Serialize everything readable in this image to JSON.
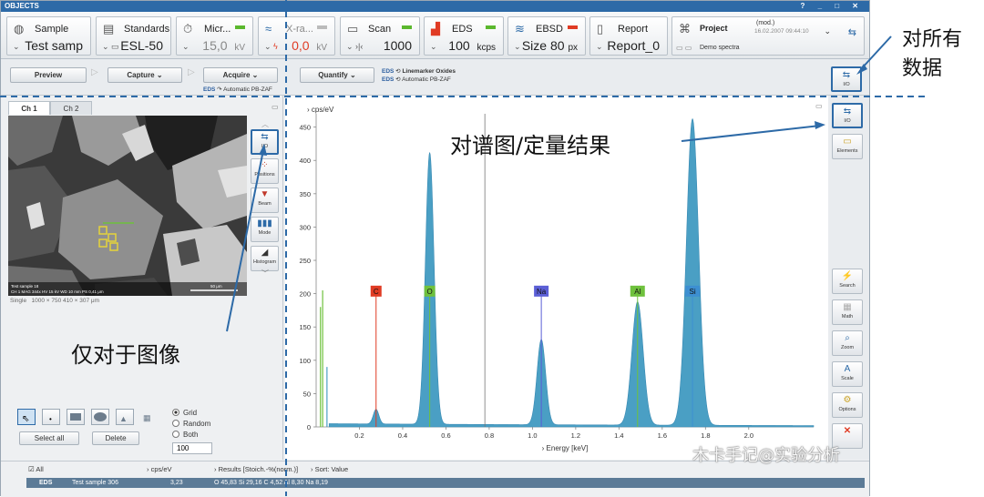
{
  "window": {
    "title": "OBJECTS",
    "controls": "? _ □ ✕"
  },
  "objects": [
    {
      "label": "Sample",
      "value": "Test samp",
      "icon": "sample-icon",
      "led": ""
    },
    {
      "label": "Standards",
      "value": "ESL-50",
      "icon": "standards-icon",
      "led": ""
    },
    {
      "label": "Micr...",
      "value": "15,0",
      "unit": "kV",
      "icon": "microscope-icon",
      "led": "#5bb82e"
    },
    {
      "label": "X-ra...",
      "value": "0,0",
      "unit": "kV",
      "icon": "xray-icon",
      "led": "#bbbbbb"
    },
    {
      "label": "Scan",
      "value": "1000",
      "icon": "scan-icon",
      "led": "#5bb82e"
    },
    {
      "label": "EDS",
      "value": "100",
      "unit": "kcps",
      "icon": "eds-icon",
      "led": "#5bb82e"
    },
    {
      "label": "EBSD",
      "value": "Size  80",
      "unit": "px",
      "icon": "ebsd-icon",
      "led": "#e03b24"
    },
    {
      "label": "Report",
      "value": "Report_0",
      "icon": "report-icon",
      "led": ""
    },
    {
      "label": "Project",
      "value": "Demo spectra",
      "note": "(mod.)",
      "date": "16.02.2007 09:44:10",
      "icon": "project-icon",
      "led": ""
    }
  ],
  "toolbar": {
    "preview": "Preview",
    "capture": "Capture",
    "acquire": "Acquire",
    "quantify": "Quantify",
    "eds_tag": "EDS",
    "automatic1": "Automatic PB-ZAF",
    "linemarker": "Linemarker Oxides",
    "automatic2": "Automatic PB-ZAF",
    "io": "I/O"
  },
  "image_panel": {
    "tabs": [
      "Ch 1",
      "Ch 2"
    ],
    "caption_mode": "Single",
    "caption_size": "1000 × 750   410 × 307 μm",
    "overlay_line1": "Test sample 18",
    "overlay_line2": "CH 1  MAG 344x  HV 15 kV  WD 10 mm  PS 0,41 μm",
    "scalebar": "50 μm",
    "tools": [
      "I/O",
      "Positions",
      "Beam",
      "Mode",
      "Histogram"
    ],
    "radio": [
      "Grid",
      "Random",
      "Both"
    ],
    "selected_radio": "Grid",
    "select_all": "Select all",
    "delete": "Delete",
    "count": "100"
  },
  "right_tools": {
    "top": [
      "I/O",
      "Elements"
    ],
    "bottom": [
      "Search",
      "Math",
      "Zoom",
      "Scale",
      "Options"
    ]
  },
  "bottom": {
    "all": "All",
    "unit": "cps/eV",
    "results": "Results [Stoich.-%(norm.)]",
    "sort": "Sort: Value",
    "row_tag": "EDS",
    "row_name": "Test sample 306",
    "row_value": "3,23",
    "row_results": "O 45,83   Si 29,16   C 4,52   Al 8,30   Na 8,19"
  },
  "annotations": {
    "all_data": "对所有\n数据",
    "spectrum": "对谱图/定量结果",
    "image_only": "仅对于图像",
    "watermark": "木卡手记@实验分析"
  },
  "chart_data": {
    "type": "line",
    "title": "",
    "xlabel": "Energy [keV]",
    "ylabel": "cps/eV",
    "xlim": [
      0,
      2.3
    ],
    "ylim": [
      0,
      470
    ],
    "xticks": [
      0.2,
      0.4,
      0.6,
      0.8,
      1.0,
      1.2,
      1.4,
      1.6,
      1.8,
      2.0
    ],
    "yticks": [
      0,
      50,
      100,
      150,
      200,
      250,
      300,
      350,
      400,
      450
    ],
    "cursor_x": 0.78,
    "series": [
      {
        "color": "#4a9fc4",
        "peaks": [
          {
            "x": 0.277,
            "height": 22,
            "width": 0.013
          },
          {
            "x": 0.525,
            "height": 408,
            "width": 0.02
          },
          {
            "x": 1.041,
            "height": 128,
            "width": 0.02
          },
          {
            "x": 1.486,
            "height": 185,
            "width": 0.026
          },
          {
            "x": 1.74,
            "height": 460,
            "width": 0.028
          }
        ],
        "background": 5
      }
    ],
    "markers": [
      {
        "label": "C",
        "x": 0.277,
        "color": "#e03b24"
      },
      {
        "label": "O",
        "x": 0.525,
        "color": "#6fc13d"
      },
      {
        "label": "Na",
        "x": 1.041,
        "color": "#5b5fd6"
      },
      {
        "label": "Al",
        "x": 1.486,
        "color": "#6fc13d"
      },
      {
        "label": "Si",
        "x": 1.74,
        "color": "#3d8fd1"
      }
    ],
    "low_energy_lines": [
      {
        "x": 0.02,
        "height": 180,
        "color": "#6fc13d"
      },
      {
        "x": 0.03,
        "height": 205,
        "color": "#6fc13d"
      },
      {
        "x": 0.05,
        "height": 90,
        "color": "#4a9fc4"
      }
    ]
  }
}
